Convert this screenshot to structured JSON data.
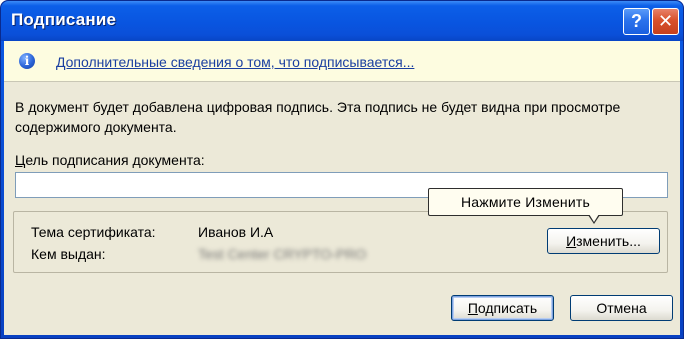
{
  "window": {
    "title": "Подписание",
    "help_glyph": "?",
    "close_glyph": "✕"
  },
  "info_bar": {
    "icon": "info-icon",
    "link_text": "Дополнительные сведения о том, что подписывается..."
  },
  "description": "В документ будет добавлена цифровая подпись. Эта подпись не будет видна при просмотре содержимого документа.",
  "purpose": {
    "label_accel": "Ц",
    "label_rest": "ель подписания документа:",
    "value": "",
    "placeholder": ""
  },
  "certificate": {
    "subject_label": "Тема сертификата:",
    "subject_value": "Иванов И.А",
    "issuer_label": "Кем выдан:",
    "issuer_value": "Test Center CRYPTO-PRO"
  },
  "callout": {
    "text": "Нажмите Изменить"
  },
  "buttons": {
    "change_accel": "И",
    "change_rest": "зменить...",
    "sign_accel": "П",
    "sign_rest": "одписать",
    "cancel": "Отмена"
  },
  "colors": {
    "titlebar": "#0a4fd8",
    "client_bg": "#ece9d8",
    "info_bg": "#fdfce0",
    "link": "#1a3fa0",
    "close_button": "#d9502b"
  }
}
